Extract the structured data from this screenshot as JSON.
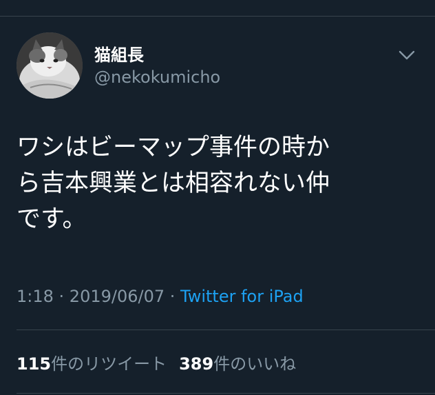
{
  "user": {
    "display_name": "猫組長",
    "handle": "@nekokumicho"
  },
  "tweet": {
    "text_line1": "ワシはビーマップ事件の時か",
    "text_line2": "ら吉本興業とは相容れない仲",
    "text_line3": "です。",
    "time": "1:18",
    "separator1": " · ",
    "date": "2019/06/07",
    "separator2": " · ",
    "source": "Twitter for iPad"
  },
  "stats": {
    "retweet_count": "115",
    "retweet_label": "件のリツイート",
    "like_count": "389",
    "like_label": "件のいいね"
  },
  "icons": {
    "menu": "chevron-down-icon",
    "avatar": "cat-avatar"
  },
  "colors": {
    "background": "#15202b",
    "secondary_text": "#8899a6",
    "link": "#1da1f2",
    "divider": "#38444d"
  }
}
